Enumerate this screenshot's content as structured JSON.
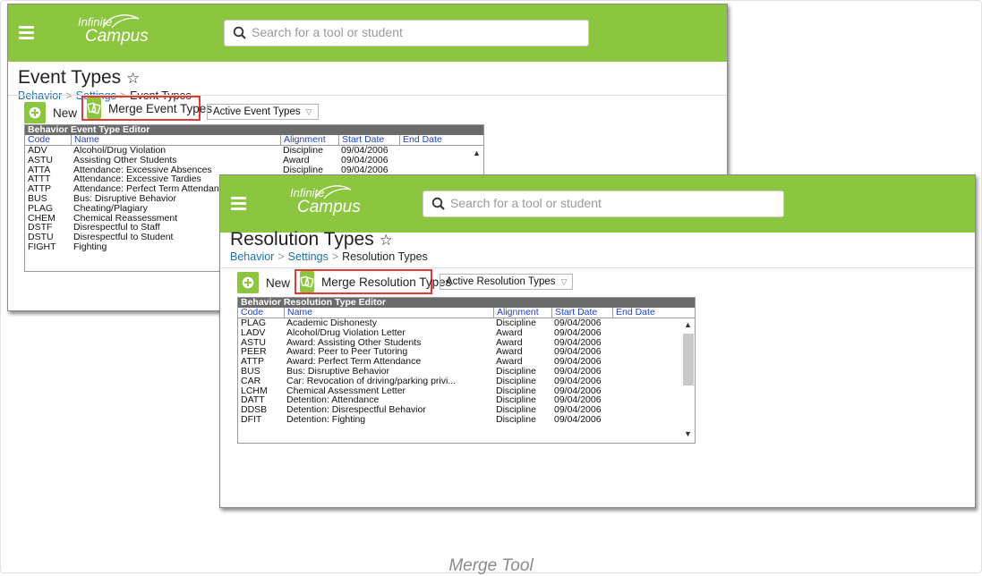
{
  "event_window": {
    "brand": {
      "line1": "Infinite",
      "line2": "Campus"
    },
    "search": {
      "placeholder": "Search for a tool or student"
    },
    "page_title": "Event Types",
    "breadcrumb": {
      "root": "Behavior",
      "mid": "Settings",
      "current": "Event Types"
    },
    "toolbar": {
      "new_label": "New",
      "merge_label": "Merge Event Types",
      "filter_value": "Active Event Types"
    },
    "grid": {
      "title": "Behavior Event Type Editor",
      "columns": [
        "Code",
        "Name",
        "Alignment",
        "Start Date",
        "End Date"
      ],
      "rows": [
        {
          "code": "ADV",
          "name": "Alcohol/Drug Violation",
          "alignment": "Discipline",
          "start": "09/04/2006",
          "end": ""
        },
        {
          "code": "ASTU",
          "name": "Assisting Other Students",
          "alignment": "Award",
          "start": "09/04/2006",
          "end": ""
        },
        {
          "code": "ATTA",
          "name": "Attendance: Excessive Absences",
          "alignment": "Discipline",
          "start": "09/04/2006",
          "end": ""
        },
        {
          "code": "ATTT",
          "name": "Attendance: Excessive Tardies",
          "alignment": "",
          "start": "",
          "end": ""
        },
        {
          "code": "ATTP",
          "name": "Attendance: Perfect Term Attendance",
          "alignment": "",
          "start": "",
          "end": ""
        },
        {
          "code": "BUS",
          "name": "Bus: Disruptive Behavior",
          "alignment": "",
          "start": "",
          "end": ""
        },
        {
          "code": "PLAG",
          "name": "Cheating/Plagiary",
          "alignment": "",
          "start": "",
          "end": ""
        },
        {
          "code": "CHEM",
          "name": "Chemical Reassessment",
          "alignment": "",
          "start": "",
          "end": ""
        },
        {
          "code": "DSTF",
          "name": "Disrespectful to Staff",
          "alignment": "",
          "start": "",
          "end": ""
        },
        {
          "code": "DSTU",
          "name": "Disrespectful to Student",
          "alignment": "",
          "start": "",
          "end": ""
        },
        {
          "code": "FIGHT",
          "name": "Fighting",
          "alignment": "",
          "start": "",
          "end": ""
        }
      ]
    }
  },
  "resolution_window": {
    "brand": {
      "line1": "Infinite",
      "line2": "Campus"
    },
    "search": {
      "placeholder": "Search for a tool or student"
    },
    "page_title": "Resolution Types",
    "breadcrumb": {
      "root": "Behavior",
      "mid": "Settings",
      "current": "Resolution Types"
    },
    "toolbar": {
      "new_label": "New",
      "merge_label": "Merge Resolution Types",
      "filter_value": "Active Resolution Types"
    },
    "grid": {
      "title": "Behavior Resolution Type Editor",
      "columns": [
        "Code",
        "Name",
        "Alignment",
        "Start Date",
        "End Date"
      ],
      "rows": [
        {
          "code": "PLAG",
          "name": "Academic Dishonesty",
          "alignment": "Discipline",
          "start": "09/04/2006",
          "end": ""
        },
        {
          "code": "LADV",
          "name": "Alcohol/Drug Violation Letter",
          "alignment": "Award",
          "start": "09/04/2006",
          "end": ""
        },
        {
          "code": "ASTU",
          "name": "Award: Assisting Other Students",
          "alignment": "Award",
          "start": "09/04/2006",
          "end": ""
        },
        {
          "code": "PEER",
          "name": "Award: Peer to Peer Tutoring",
          "alignment": "Award",
          "start": "09/04/2006",
          "end": ""
        },
        {
          "code": "ATTP",
          "name": "Award: Perfect Term Attendance",
          "alignment": "Award",
          "start": "09/04/2006",
          "end": ""
        },
        {
          "code": "BUS",
          "name": "Bus: Disruptive Behavior",
          "alignment": "Discipline",
          "start": "09/04/2006",
          "end": ""
        },
        {
          "code": "CAR",
          "name": "Car: Revocation of driving/parking privi...",
          "alignment": "Discipline",
          "start": "09/04/2006",
          "end": ""
        },
        {
          "code": "LCHM",
          "name": "Chemical Assessment Letter",
          "alignment": "Discipline",
          "start": "09/04/2006",
          "end": ""
        },
        {
          "code": "DATT",
          "name": "Detention: Attendance",
          "alignment": "Discipline",
          "start": "09/04/2006",
          "end": ""
        },
        {
          "code": "DDSB",
          "name": "Detention: Disrespectful Behavior",
          "alignment": "Discipline",
          "start": "09/04/2006",
          "end": ""
        },
        {
          "code": "DFIT",
          "name": "Detention: Fighting",
          "alignment": "Discipline",
          "start": "09/04/2006",
          "end": ""
        }
      ]
    }
  },
  "caption": "Merge Tool",
  "colors": {
    "brand_green": "#8cc63f",
    "highlight_red": "#e53935",
    "link_blue": "#1a6fb5"
  }
}
